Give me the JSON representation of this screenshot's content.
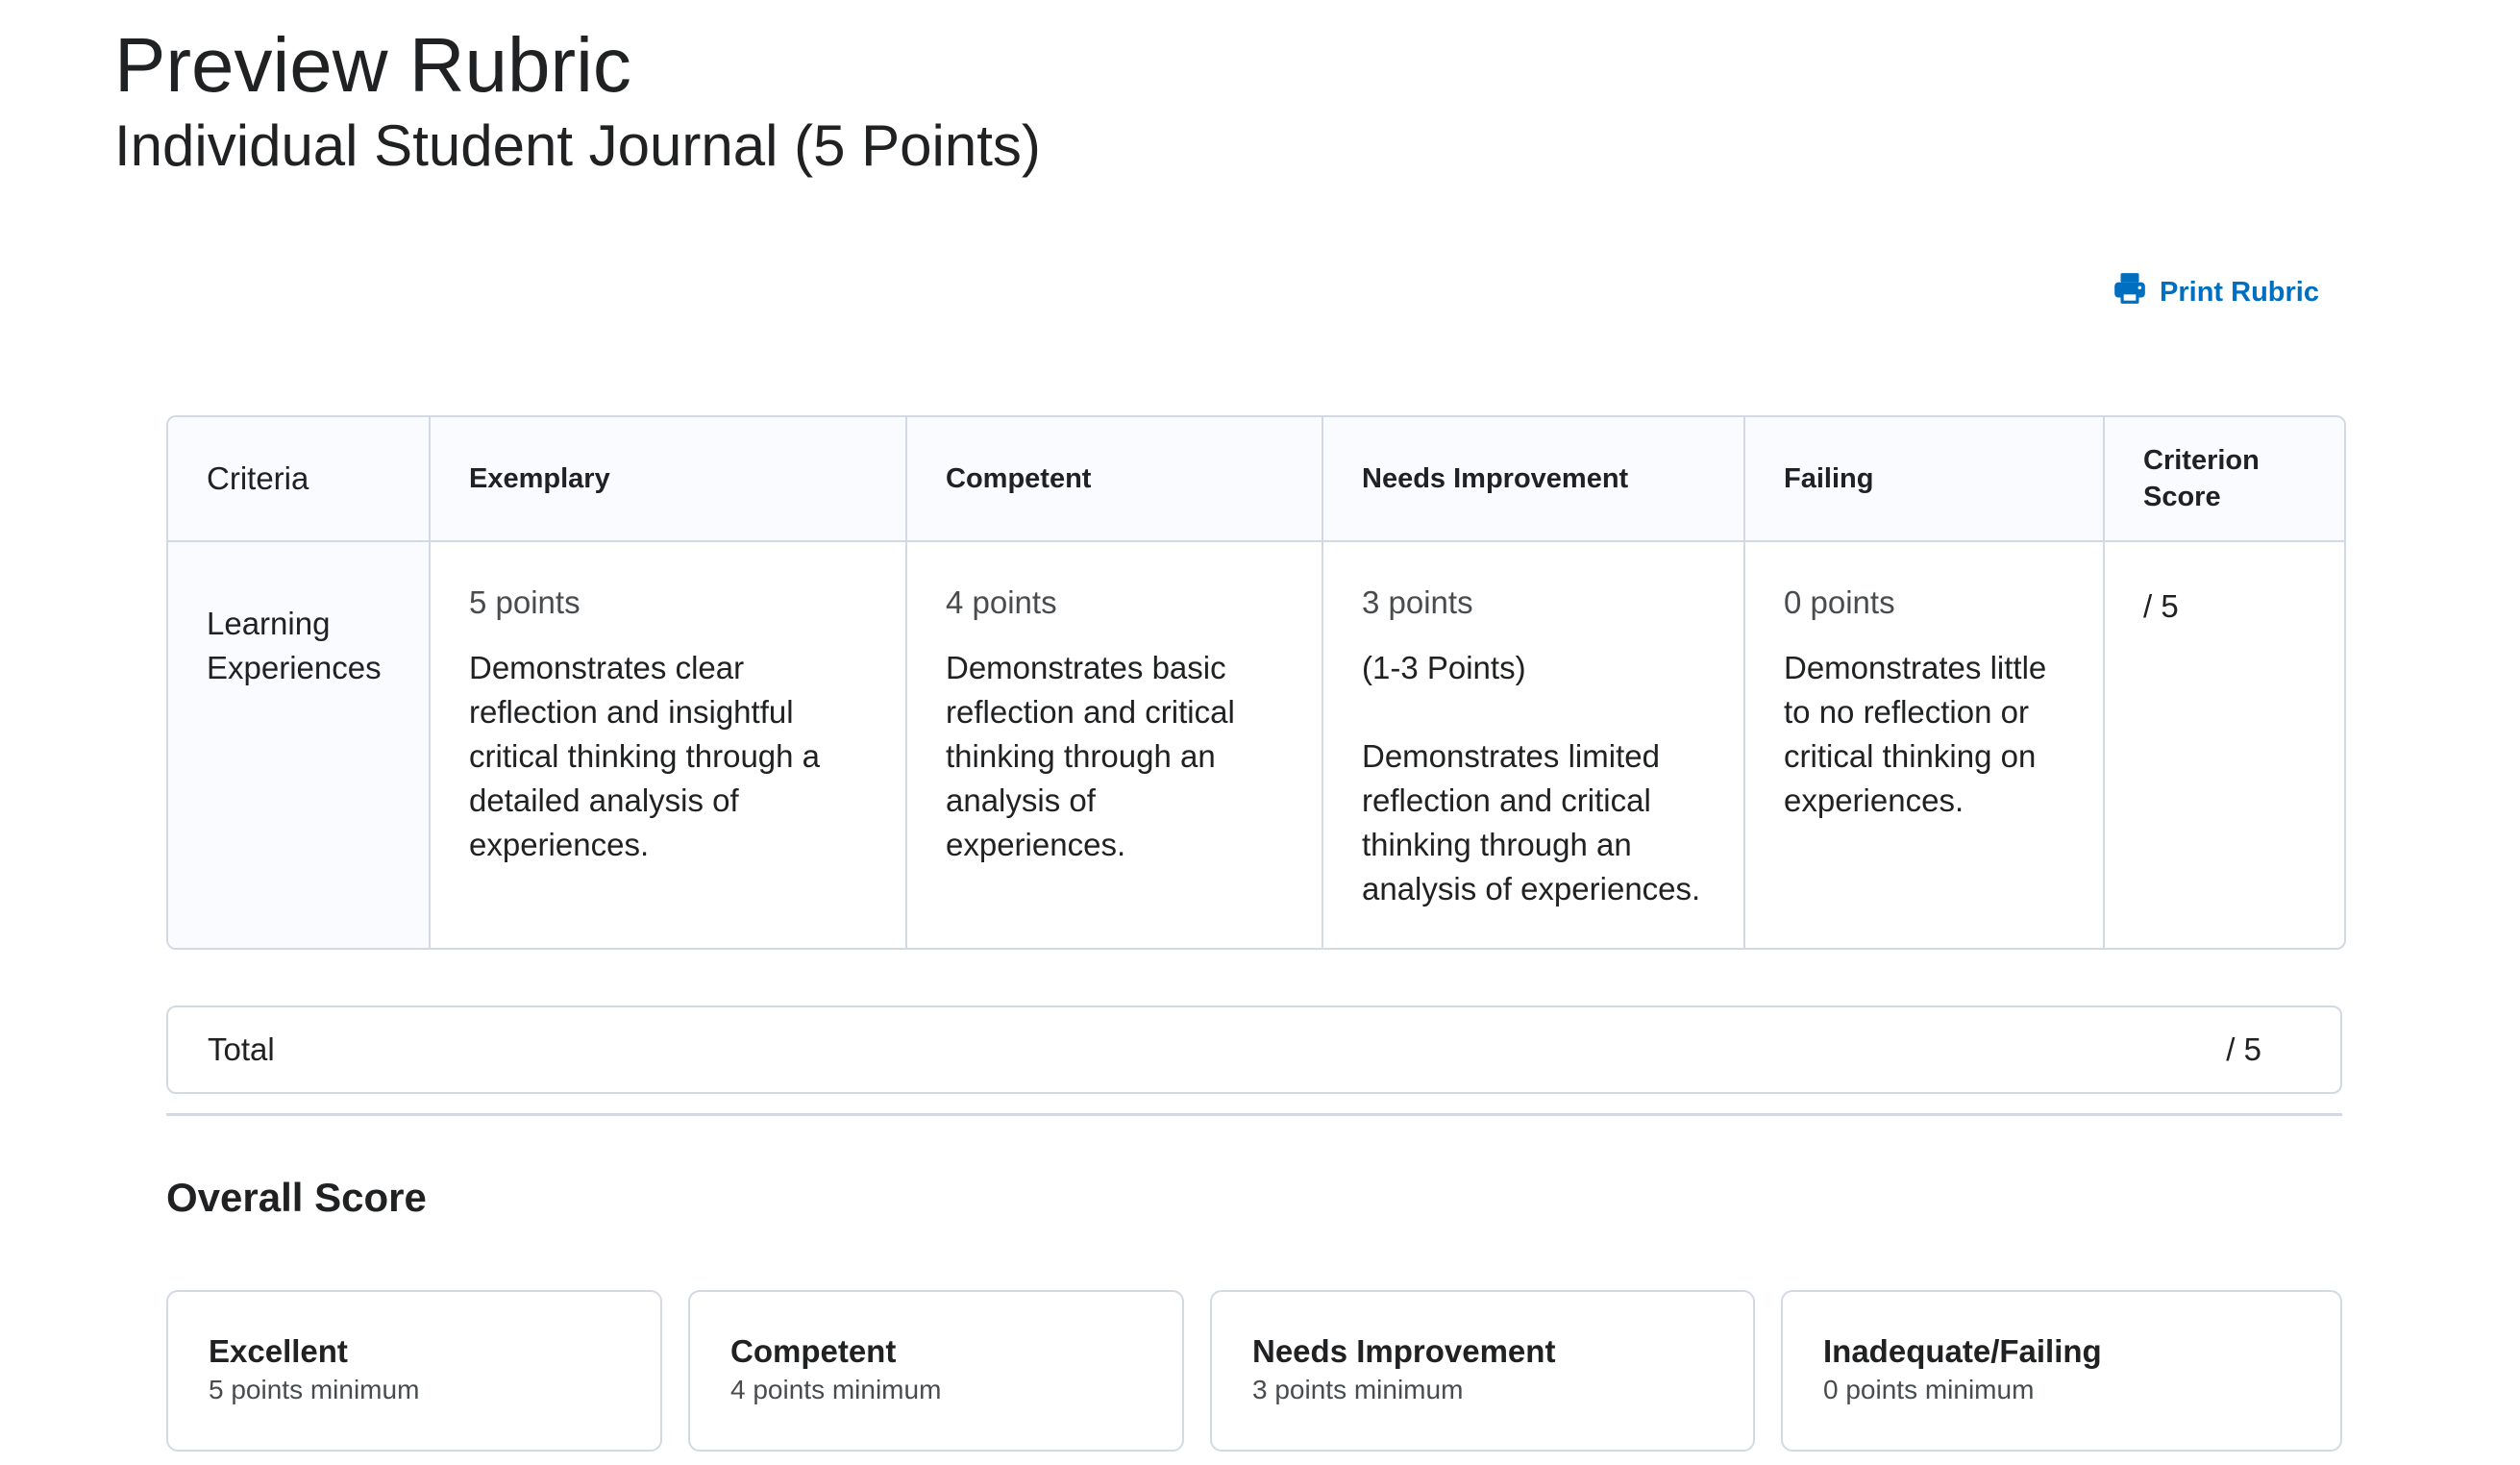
{
  "header": {
    "title": "Preview Rubric",
    "subtitle": "Individual Student Journal (5 Points)"
  },
  "print": {
    "label": "Print Rubric",
    "icon": "printer-icon",
    "color": "#006fbf"
  },
  "table": {
    "columns": [
      "Criteria",
      "Exemplary",
      "Competent",
      "Needs Improvement",
      "Failing",
      "Criterion Score"
    ],
    "rows": [
      {
        "criterion": "Learning Experiences",
        "cells": [
          {
            "points": "5 points",
            "description": "Demonstrates clear reflection and insightful critical thinking through a detailed analysis of experiences."
          },
          {
            "points": "4 points",
            "description": "Demonstrates basic reflection and critical thinking through an analysis of experiences."
          },
          {
            "points": "3 points",
            "description": "(1-3 Points)\n\nDemonstrates limited reflection and critical thinking through an analysis of experiences."
          },
          {
            "points": "0 points",
            "description": "Demonstrates little to no reflection or critical thinking on experiences."
          }
        ],
        "score": "/ 5"
      }
    ]
  },
  "total": {
    "label": "Total",
    "value": "/ 5"
  },
  "overall": {
    "title": "Overall Score",
    "levels": [
      {
        "name": "Excellent",
        "minimum": "5 points minimum"
      },
      {
        "name": "Competent",
        "minimum": "4 points minimum"
      },
      {
        "name": "Needs Improvement",
        "minimum": "3 points minimum"
      },
      {
        "name": "Inadequate/Failing",
        "minimum": "0 points minimum"
      }
    ]
  }
}
